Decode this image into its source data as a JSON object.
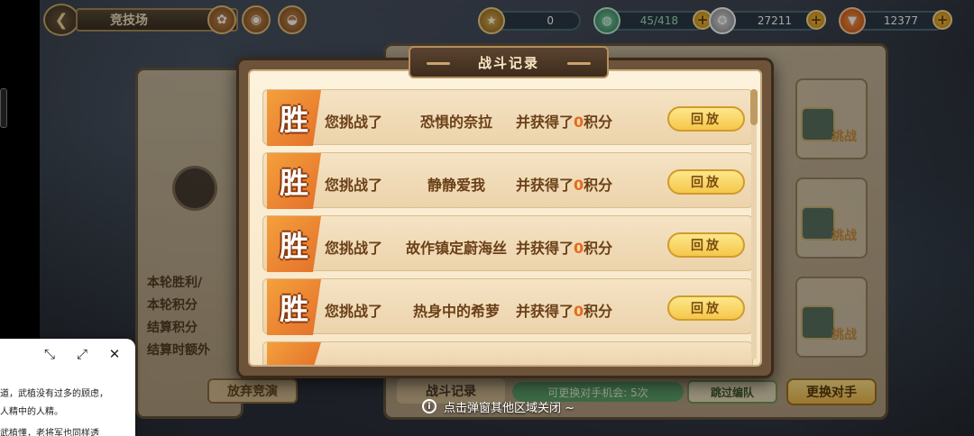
{
  "topbar": {
    "title": "竞技场",
    "resources": [
      {
        "icon": "medal-icon",
        "value": "0",
        "has_plus": false
      },
      {
        "icon": "stamina-icon",
        "value": "45/418",
        "has_plus": true
      },
      {
        "icon": "coin-icon",
        "value": "27211",
        "has_plus": true
      },
      {
        "icon": "carrot-icon",
        "value": "12377",
        "has_plus": true
      }
    ]
  },
  "left_panel": {
    "lines": [
      "本轮胜利/",
      "本轮积分",
      "结算积分",
      "结算时额外"
    ],
    "give_up": "放弃竞演"
  },
  "bottom_bar": {
    "record": "战斗记录",
    "free_change": "可更换对手机会: 5次",
    "skip": "跳过编队",
    "change": "更换对手"
  },
  "opponents": {
    "challenge_label": "挑战"
  },
  "modal": {
    "title": "战斗记录",
    "records": [
      {
        "result": "胜",
        "prefix": "您挑战了",
        "opponent": "恐惧的奈拉",
        "suffix_a": "并获得了",
        "score": "0",
        "suffix_b": "积分",
        "replay": "回放"
      },
      {
        "result": "胜",
        "prefix": "您挑战了",
        "opponent": "静静爱我",
        "suffix_a": "并获得了",
        "score": "0",
        "suffix_b": "积分",
        "replay": "回放"
      },
      {
        "result": "胜",
        "prefix": "您挑战了",
        "opponent": "故作镇定蔚海丝",
        "suffix_a": "并获得了",
        "score": "0",
        "suffix_b": "积分",
        "replay": "回放"
      },
      {
        "result": "胜",
        "prefix": "您挑战了",
        "opponent": "热身中的希萝",
        "suffix_a": "并获得了",
        "score": "0",
        "suffix_b": "积分",
        "replay": "回放"
      }
    ]
  },
  "hint": "点击弹窗其他区域关闭 ~",
  "float_window": {
    "lines": [
      "道，武植没有过多的顾虑，",
      "人精中的人精。",
      "武植懂，老将军也同样透"
    ]
  }
}
